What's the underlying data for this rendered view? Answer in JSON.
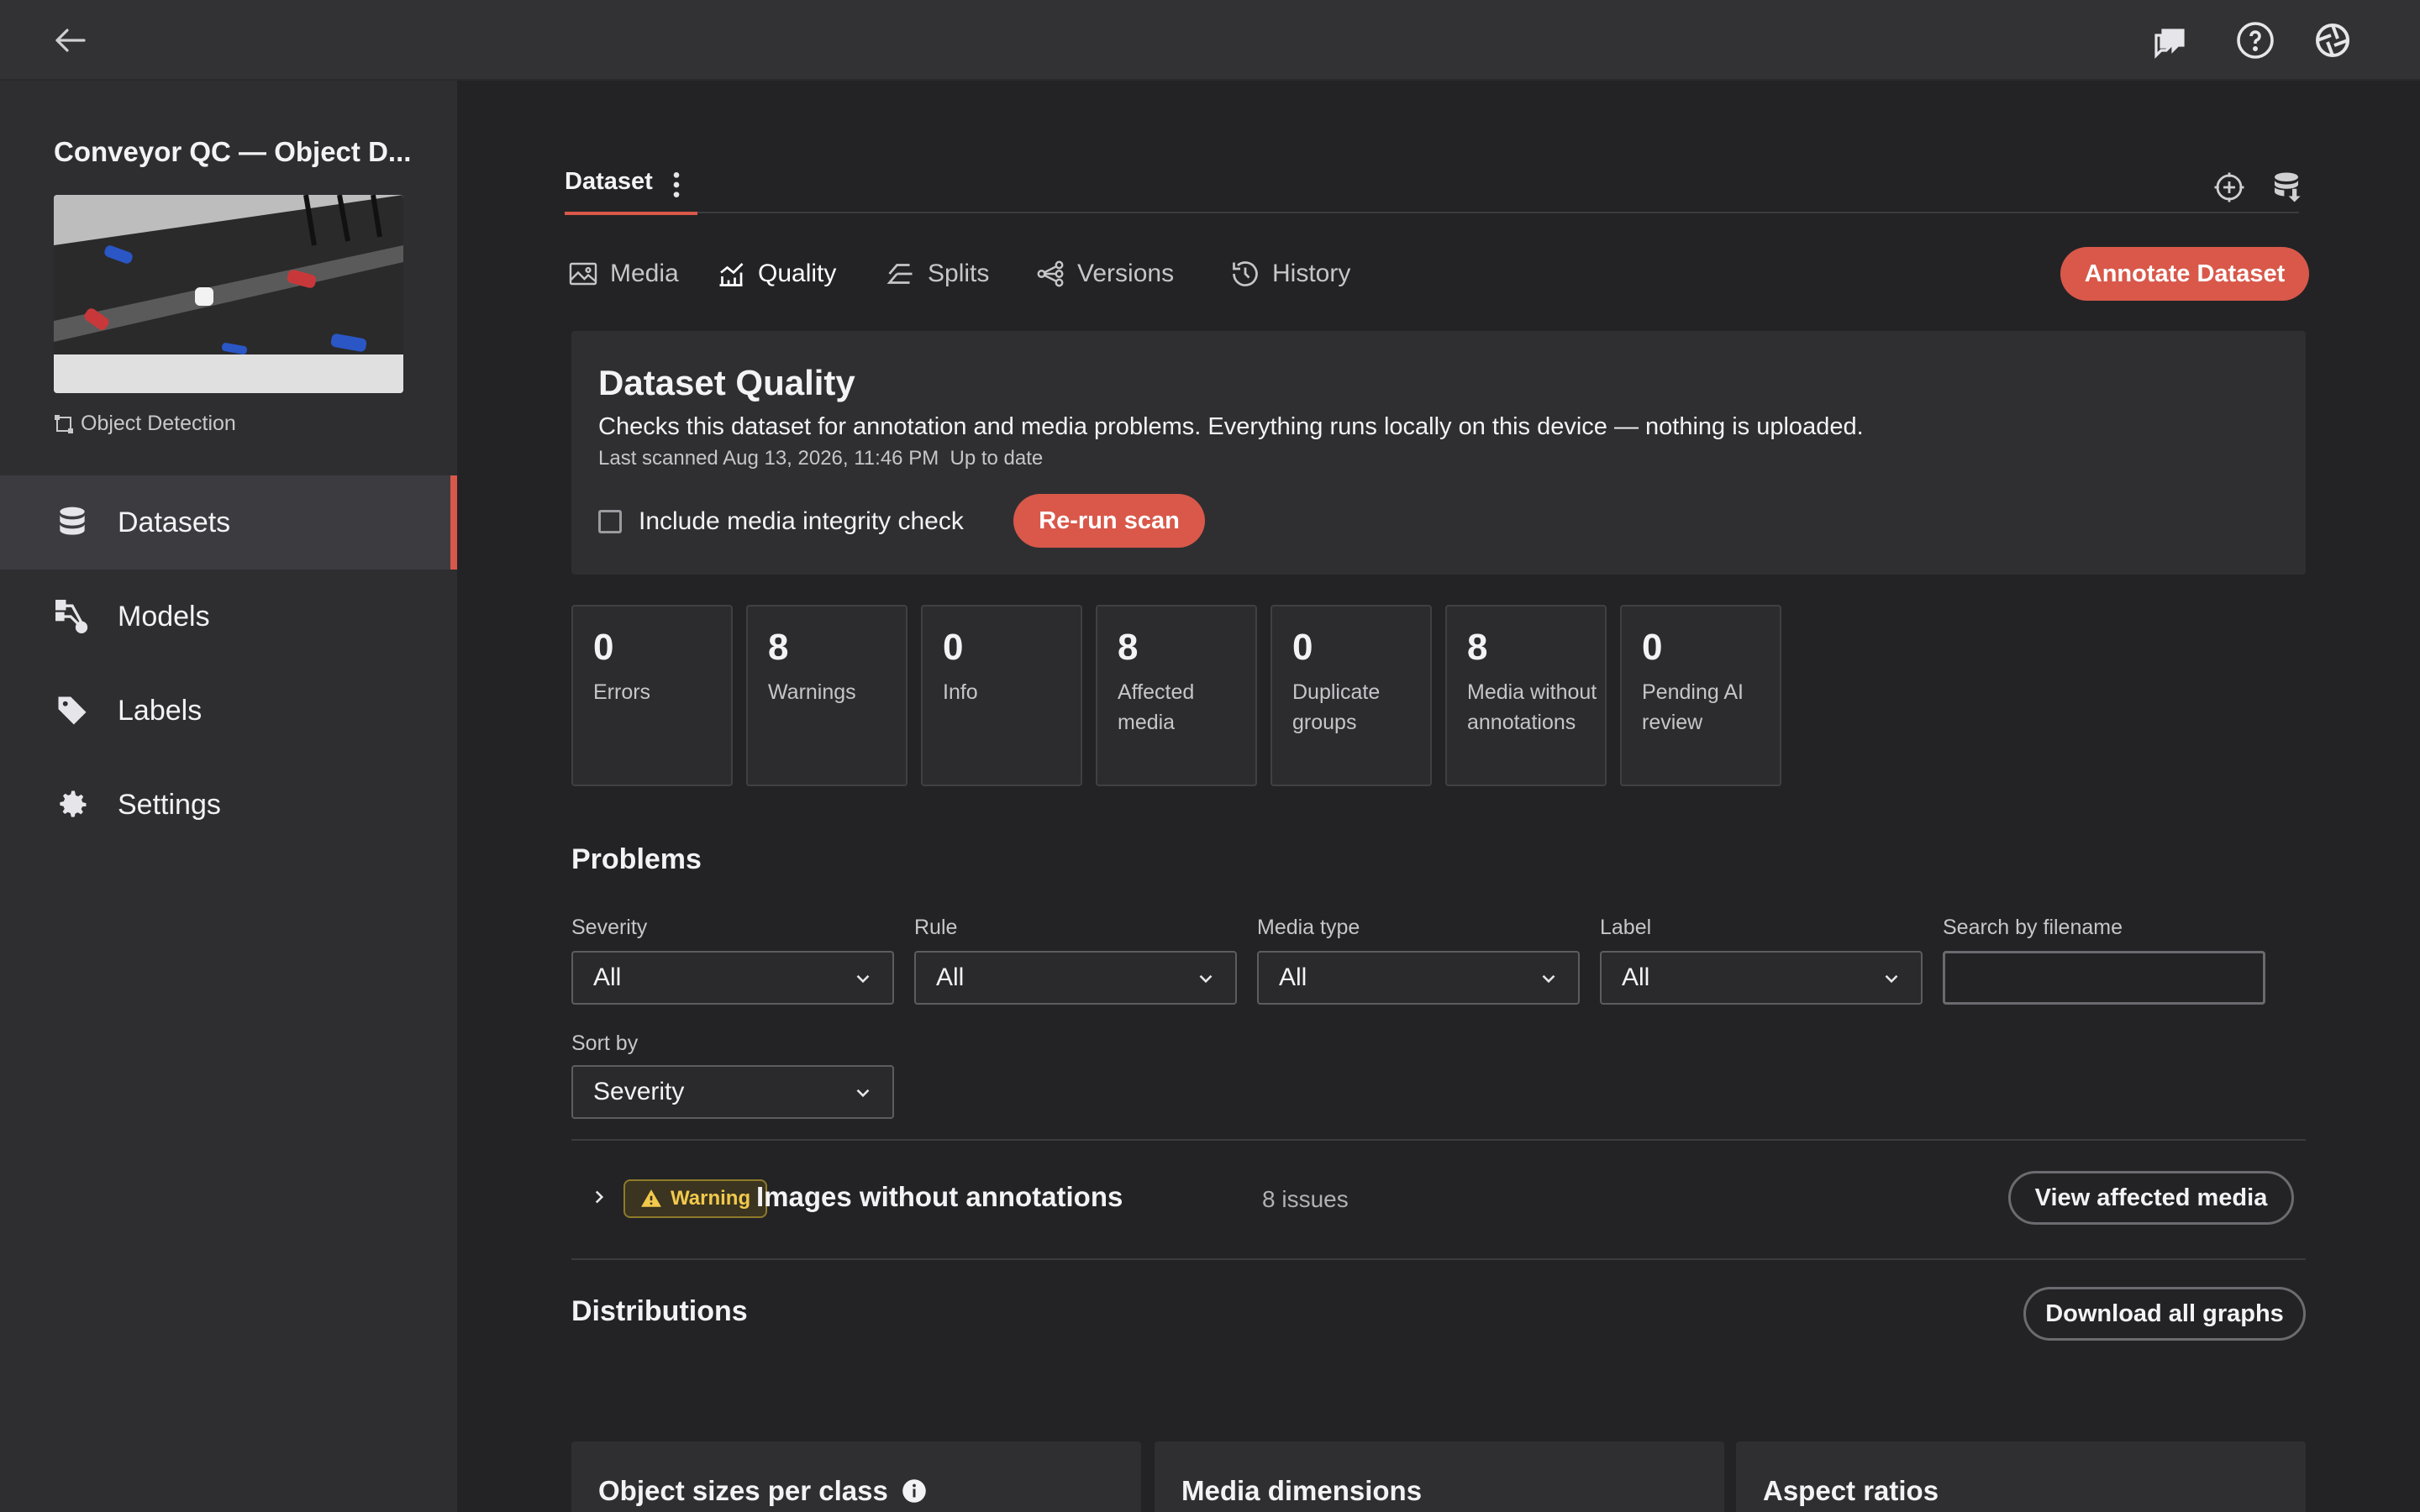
{
  "sidebar": {
    "project_title": "Conveyor QC — Object D...",
    "project_type": "Object Detection",
    "nav": [
      {
        "label": "Datasets"
      },
      {
        "label": "Models"
      },
      {
        "label": "Labels"
      },
      {
        "label": "Settings"
      }
    ],
    "active_nav": "Datasets"
  },
  "main": {
    "dataset_tab": "Dataset",
    "subtabs": [
      {
        "label": "Media"
      },
      {
        "label": "Quality"
      },
      {
        "label": "Splits"
      },
      {
        "label": "Versions"
      },
      {
        "label": "History"
      }
    ],
    "active_subtab": "Quality",
    "annotate_button": "Annotate Dataset",
    "quality": {
      "title": "Dataset Quality",
      "description": "Checks this dataset for annotation and media problems. Everything runs locally on this device — nothing is uploaded.",
      "scan_status": "Last scanned Aug 13, 2026, 11:46 PM  Up to date",
      "integrity_check_label": "Include media integrity check",
      "rerun_button": "Re-run scan"
    },
    "stats": [
      {
        "value": "0",
        "label": "Errors"
      },
      {
        "value": "8",
        "label": "Warnings"
      },
      {
        "value": "0",
        "label": "Info"
      },
      {
        "value": "8",
        "label": "Affected media"
      },
      {
        "value": "0",
        "label": "Duplicate groups"
      },
      {
        "value": "8",
        "label": "Media without annotations"
      },
      {
        "value": "0",
        "label": "Pending AI review"
      }
    ],
    "problems": {
      "title": "Problems",
      "filters": [
        {
          "label": "Severity",
          "value": "All"
        },
        {
          "label": "Rule",
          "value": "All"
        },
        {
          "label": "Media type",
          "value": "All"
        },
        {
          "label": "Label",
          "value": "All"
        }
      ],
      "search_label": "Search by filename",
      "search_value": "",
      "sort_label": "Sort by",
      "sort_value": "Severity",
      "items": [
        {
          "severity": "Warning",
          "title": "Images without annotations",
          "count": "8 issues",
          "action": "View affected media"
        }
      ]
    },
    "distributions": {
      "title": "Distributions",
      "download_button": "Download all graphs",
      "cards": [
        {
          "title": "Object sizes per class"
        },
        {
          "title": "Media dimensions"
        },
        {
          "title": "Aspect ratios"
        }
      ]
    }
  },
  "colors": {
    "accent": "#d9584a",
    "warning": "#f2c94c",
    "background": "#232325",
    "sidebar": "#2e2e31"
  }
}
